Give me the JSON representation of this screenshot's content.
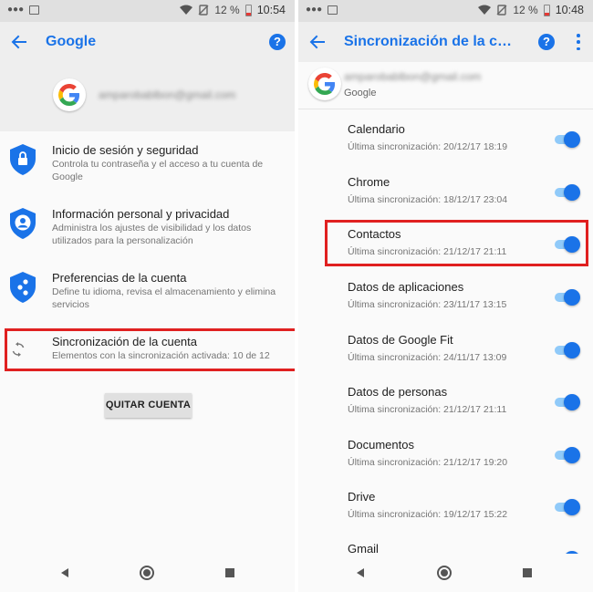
{
  "status_left": {
    "battery_pct": "12 %",
    "time": "10:54"
  },
  "status_right": {
    "battery_pct": "12 %",
    "time": "10:48"
  },
  "left": {
    "title": "Google",
    "email": "amparobablbon@gmail.com",
    "items": [
      {
        "title": "Inicio de sesión y seguridad",
        "desc": "Controla tu contraseña y el acceso a tu cuenta de Google"
      },
      {
        "title": "Información personal y privacidad",
        "desc": "Administra los ajustes de visibilidad y los datos utilizados para la personalización"
      },
      {
        "title": "Preferencias de la cuenta",
        "desc": "Define tu idioma, revisa el almacenamiento y elimina servicios"
      },
      {
        "title": "Sincronización de la cuenta",
        "desc": "Elementos con la sincronización activada: 10 de 12"
      }
    ],
    "remove_button": "QUITAR CUENTA"
  },
  "right": {
    "title": "Sincronización de la cuenta",
    "email": "amparobablbon@gmail.com",
    "provider": "Google",
    "items": [
      {
        "title": "Calendario",
        "sub": "Última sincronización: 20/12/17 18:19",
        "enabled": true
      },
      {
        "title": "Chrome",
        "sub": "Última sincronización: 18/12/17 23:04",
        "enabled": true
      },
      {
        "title": "Contactos",
        "sub": "Última sincronización: 21/12/17 21:11",
        "enabled": true
      },
      {
        "title": "Datos de aplicaciones",
        "sub": "Última sincronización: 23/11/17 13:15",
        "enabled": true
      },
      {
        "title": "Datos de Google Fit",
        "sub": "Última sincronización: 24/11/17 13:09",
        "enabled": true
      },
      {
        "title": "Datos de personas",
        "sub": "Última sincronización: 21/12/17 21:11",
        "enabled": true
      },
      {
        "title": "Documentos",
        "sub": "Última sincronización: 21/12/17 19:20",
        "enabled": true
      },
      {
        "title": "Drive",
        "sub": "Última sincronización: 19/12/17 15:22",
        "enabled": true
      },
      {
        "title": "Gmail",
        "sub": "",
        "enabled": true
      }
    ]
  },
  "icons": {
    "back": "arrow-back-icon",
    "help": "help-icon",
    "more": "more-vert-icon",
    "sync": "sync-icon",
    "help_glyph": "?"
  },
  "colors": {
    "accent": "#1a73e8",
    "highlight": "#e02020",
    "toggle_track": "#90caf9"
  }
}
